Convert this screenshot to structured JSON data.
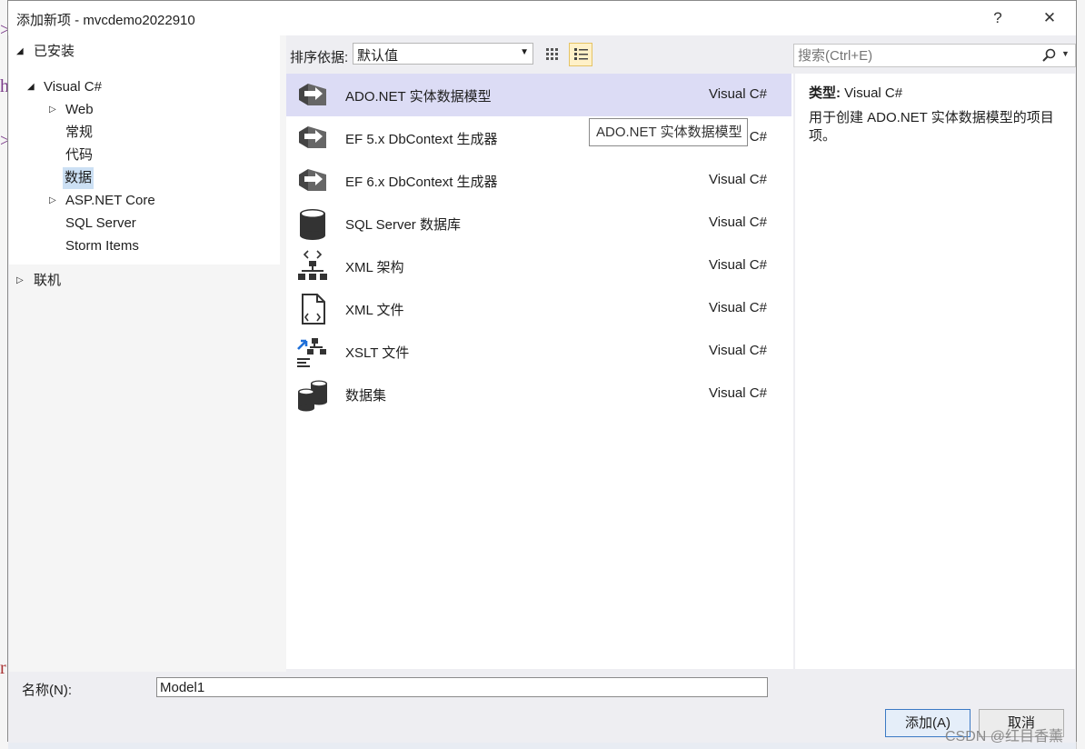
{
  "window": {
    "title": "添加新项 - mvcdemo2022910",
    "help_label": "?",
    "close_label": "✕"
  },
  "tree": {
    "installed": "已安装",
    "visual_csharp": "Visual C#",
    "web": "Web",
    "general": "常规",
    "code": "代码",
    "data": "数据",
    "aspnet_core": "ASP.NET Core",
    "sql_server": "SQL Server",
    "storm_items": "Storm Items",
    "online": "联机"
  },
  "toolbar": {
    "sort_label": "排序依据:",
    "sort_value": "默认值"
  },
  "search": {
    "placeholder": "搜索(Ctrl+E)"
  },
  "items": [
    {
      "name": "ADO.NET 实体数据模型",
      "lang": "Visual C#",
      "icon": "entity-model-icon"
    },
    {
      "name": "EF 5.x DbContext 生成器",
      "lang": "Visual C#",
      "icon": "dbcontext-generator-icon"
    },
    {
      "name": "EF 6.x DbContext 生成器",
      "lang": "Visual C#",
      "icon": "dbcontext-generator-icon"
    },
    {
      "name": "SQL Server 数据库",
      "lang": "Visual C#",
      "icon": "database-icon"
    },
    {
      "name": "XML 架构",
      "lang": "Visual C#",
      "icon": "xml-schema-icon"
    },
    {
      "name": "XML 文件",
      "lang": "Visual C#",
      "icon": "xml-file-icon"
    },
    {
      "name": "XSLT 文件",
      "lang": "Visual C#",
      "icon": "xslt-file-icon"
    },
    {
      "name": "数据集",
      "lang": "Visual C#",
      "icon": "dataset-icon"
    }
  ],
  "tooltip": "ADO.NET 实体数据模型",
  "detail": {
    "type_label": "类型:",
    "type_value": "Visual C#",
    "description": "用于创建 ADO.NET 实体数据模型的项目项。"
  },
  "bottom": {
    "name_label": "名称(N):",
    "name_value": "Model1",
    "add_button": "添加(A)",
    "cancel_button": "取消"
  },
  "watermark": "CSDN @红目香薰",
  "colors": {
    "selection": "#dcdcf5",
    "tree_selection": "#cce0f4",
    "primary_border": "#3b79c4"
  }
}
